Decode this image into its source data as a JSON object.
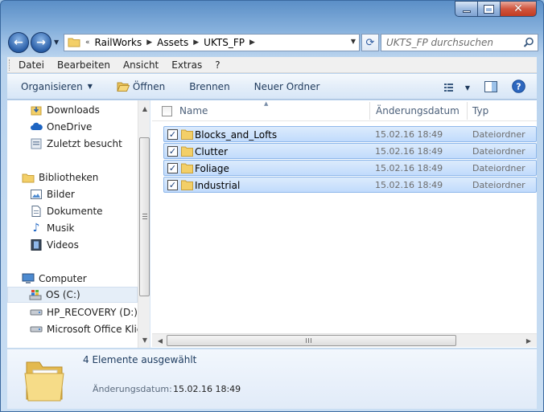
{
  "window": {
    "caption_buttons": [
      "minimize",
      "maximize",
      "close"
    ]
  },
  "address": {
    "overflow": "«",
    "crumbs": [
      "RailWorks",
      "Assets",
      "UKTS_FP"
    ]
  },
  "search": {
    "placeholder": "UKTS_FP durchsuchen"
  },
  "menu": [
    "Datei",
    "Bearbeiten",
    "Ansicht",
    "Extras",
    "?"
  ],
  "commands": {
    "organize": "Organisieren",
    "open": "Öffnen",
    "burn": "Brennen",
    "new_folder": "Neuer Ordner"
  },
  "nav": {
    "favorites": [
      "Downloads",
      "OneDrive",
      "Zuletzt besucht"
    ],
    "libraries_header": "Bibliotheken",
    "libraries": [
      "Bilder",
      "Dokumente",
      "Musik",
      "Videos"
    ],
    "computer_header": "Computer",
    "drives": [
      "OS (C:)",
      "HP_RECOVERY (D:)",
      "Microsoft Office Klick"
    ],
    "selected": "OS (C:)"
  },
  "columns": {
    "name": "Name",
    "date": "Änderungsdatum",
    "type": "Typ"
  },
  "files": [
    {
      "name": "Blocks_and_Lofts",
      "date": "15.02.16 18:49",
      "type": "Dateiordner",
      "checked": true
    },
    {
      "name": "Clutter",
      "date": "15.02.16 18:49",
      "type": "Dateiordner",
      "checked": true
    },
    {
      "name": "Foliage",
      "date": "15.02.16 18:49",
      "type": "Dateiordner",
      "checked": true
    },
    {
      "name": "Industrial",
      "date": "15.02.16 18:49",
      "type": "Dateiordner",
      "checked": true
    }
  ],
  "details": {
    "selection_count": "4 Elemente ausgewählt",
    "date_label": "Änderungsdatum:",
    "date_value": "15.02.16 18:49"
  },
  "colors": {
    "selection_fill": "#c1dbfc",
    "selection_border": "#8fb8ea",
    "folder": "#f3cf68",
    "close_button": "#c23c22"
  }
}
